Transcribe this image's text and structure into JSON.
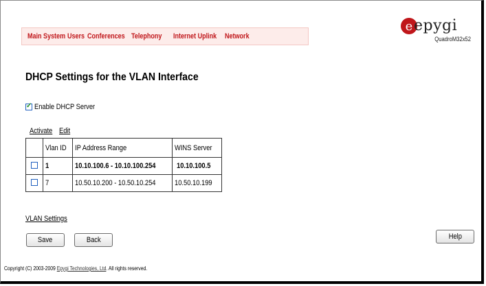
{
  "nav": {
    "items": [
      "Main",
      "System",
      "Users",
      "Conferences",
      "Telephony",
      "Internet Uplink",
      "Network"
    ]
  },
  "brand": {
    "logo_text": "epygi",
    "logo_letter": "e",
    "model": "QuadroM32x52"
  },
  "page": {
    "title": "DHCP Settings for the VLAN Interface"
  },
  "enable_dhcp": {
    "label": "Enable DHCP Server",
    "checked": true
  },
  "actions": {
    "activate": "Activate",
    "edit": "Edit"
  },
  "table": {
    "headers": [
      "Vlan ID",
      "IP Address Range",
      "WINS Server"
    ],
    "rows": [
      {
        "vlan_id": "1",
        "ip_range": "10.10.100.6 - 10.10.100.254",
        "wins": "10.10.100.5",
        "bold": true
      },
      {
        "vlan_id": "7",
        "ip_range": "10.50.10.200 - 10.50.10.254",
        "wins": "10.50.10.199",
        "bold": false
      }
    ]
  },
  "links": {
    "vlan_settings": "VLAN Settings"
  },
  "buttons": {
    "save": "Save",
    "back": "Back",
    "help": "Help"
  },
  "footer": {
    "prefix": "Copyright (C) 2003-2009 ",
    "company": "Epygi Technologies, Ltd",
    "suffix": ". All rights reserved."
  },
  "colors": {
    "nav_text": "#c0161a",
    "nav_bg": "#fdecea",
    "logo_accent": "#c0161a"
  }
}
